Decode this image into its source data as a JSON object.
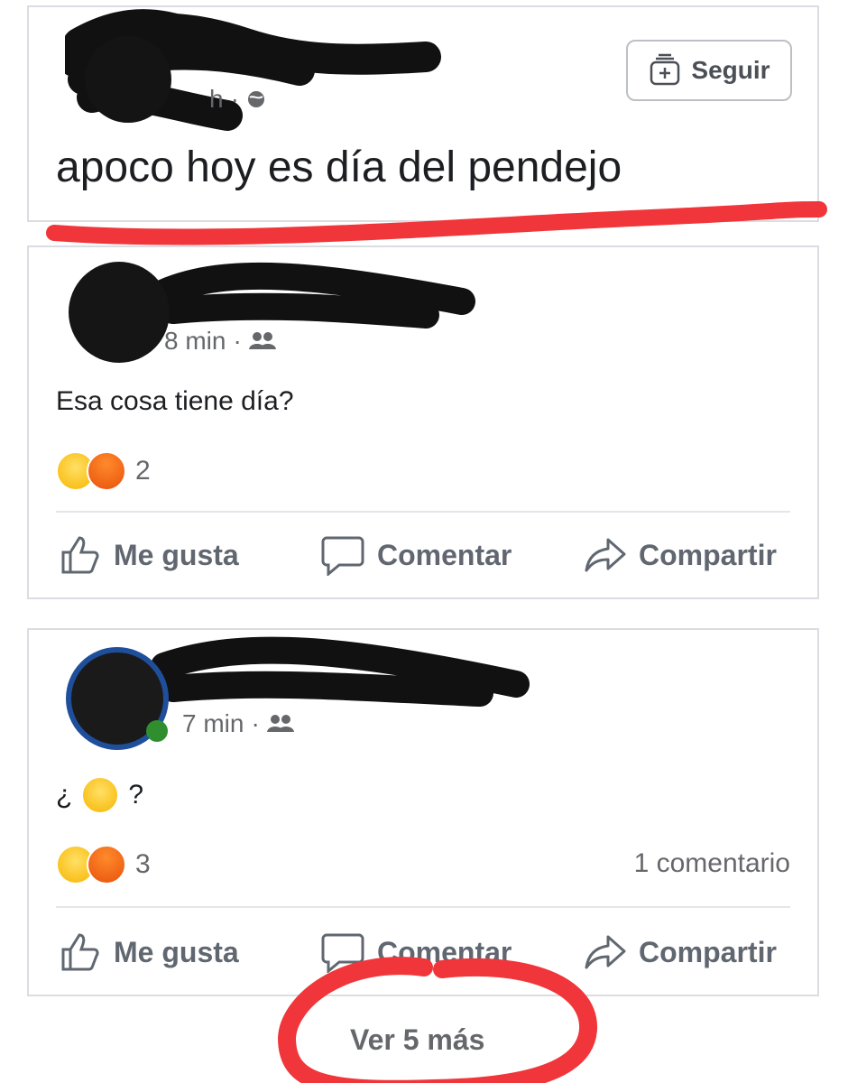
{
  "post": {
    "follow_label": "Seguir",
    "text": "apoco hoy es día del pendejo",
    "time_fragment": "h"
  },
  "comments": [
    {
      "time": "8 min",
      "text": "Esa cosa tiene día?",
      "reaction_count": "2",
      "comment_count": "",
      "actions": {
        "like": "Me gusta",
        "comment": "Comentar",
        "share": "Compartir"
      }
    },
    {
      "time": "7 min",
      "text_prefix": "¿",
      "text_suffix": "?",
      "reaction_count": "3",
      "comment_count": "1 comentario",
      "actions": {
        "like": "Me gusta",
        "comment": "Comentar",
        "share": "Compartir"
      }
    }
  ],
  "see_more_label": "Ver 5 más",
  "colors": {
    "annotation_red": "#f0363a",
    "censor_black": "#111111",
    "muted_text": "#65676b"
  },
  "icons": [
    "follow-plus-icon",
    "globe-icon",
    "friends-icon",
    "like-icon",
    "comment-icon",
    "share-icon",
    "laugh-reaction-icon",
    "angry-reaction-icon",
    "woozy-face-icon"
  ]
}
